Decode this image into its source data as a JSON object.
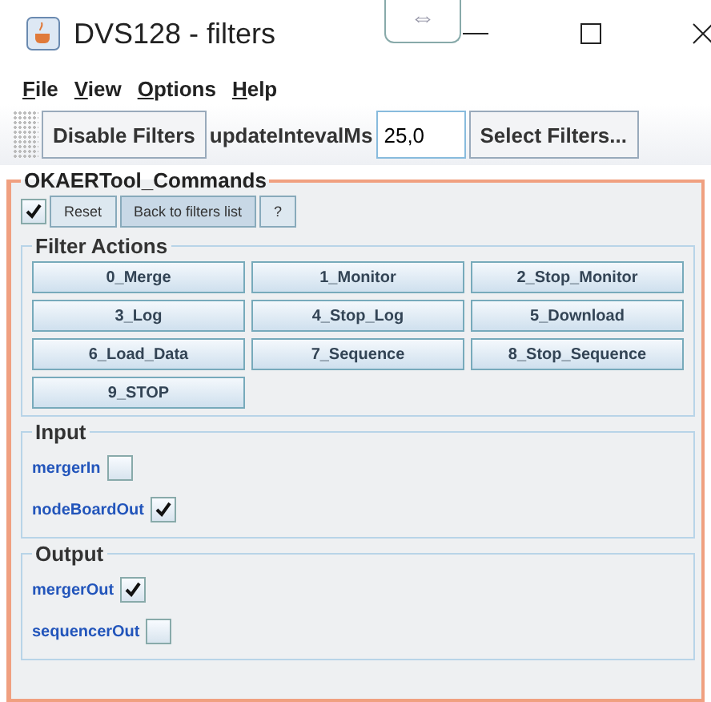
{
  "window": {
    "title": "DVS128 - filters",
    "floating_tab": "⇔"
  },
  "menu": [
    {
      "label": "File"
    },
    {
      "label": "View"
    },
    {
      "label": "Options"
    },
    {
      "label": "Help"
    }
  ],
  "toolbar": {
    "disable_button": "Disable Filters",
    "interval_label": "updateIntevalMs",
    "interval_value": "25,0",
    "select_button": "Select Filters..."
  },
  "panel": {
    "title": "OKAERTool_Commands",
    "enabled": true,
    "buttons": [
      "Reset",
      "Back to filters list",
      "?"
    ],
    "filter_actions": {
      "title": "Filter Actions",
      "buttons": [
        "0_Merge",
        "1_Monitor",
        "2_Stop_Monitor",
        "3_Log",
        "4_Stop_Log",
        "5_Download",
        "6_Load_Data",
        "7_Sequence",
        "8_Stop_Sequence",
        "9_STOP"
      ]
    },
    "groups": [
      {
        "title": "Input",
        "options": [
          {
            "label": "mergerIn",
            "checked": false
          },
          {
            "label": "nodeBoardOut",
            "checked": true
          }
        ]
      },
      {
        "title": "Output",
        "options": [
          {
            "label": "mergerOut",
            "checked": true
          },
          {
            "label": "sequencerOut",
            "checked": false
          }
        ]
      }
    ]
  }
}
